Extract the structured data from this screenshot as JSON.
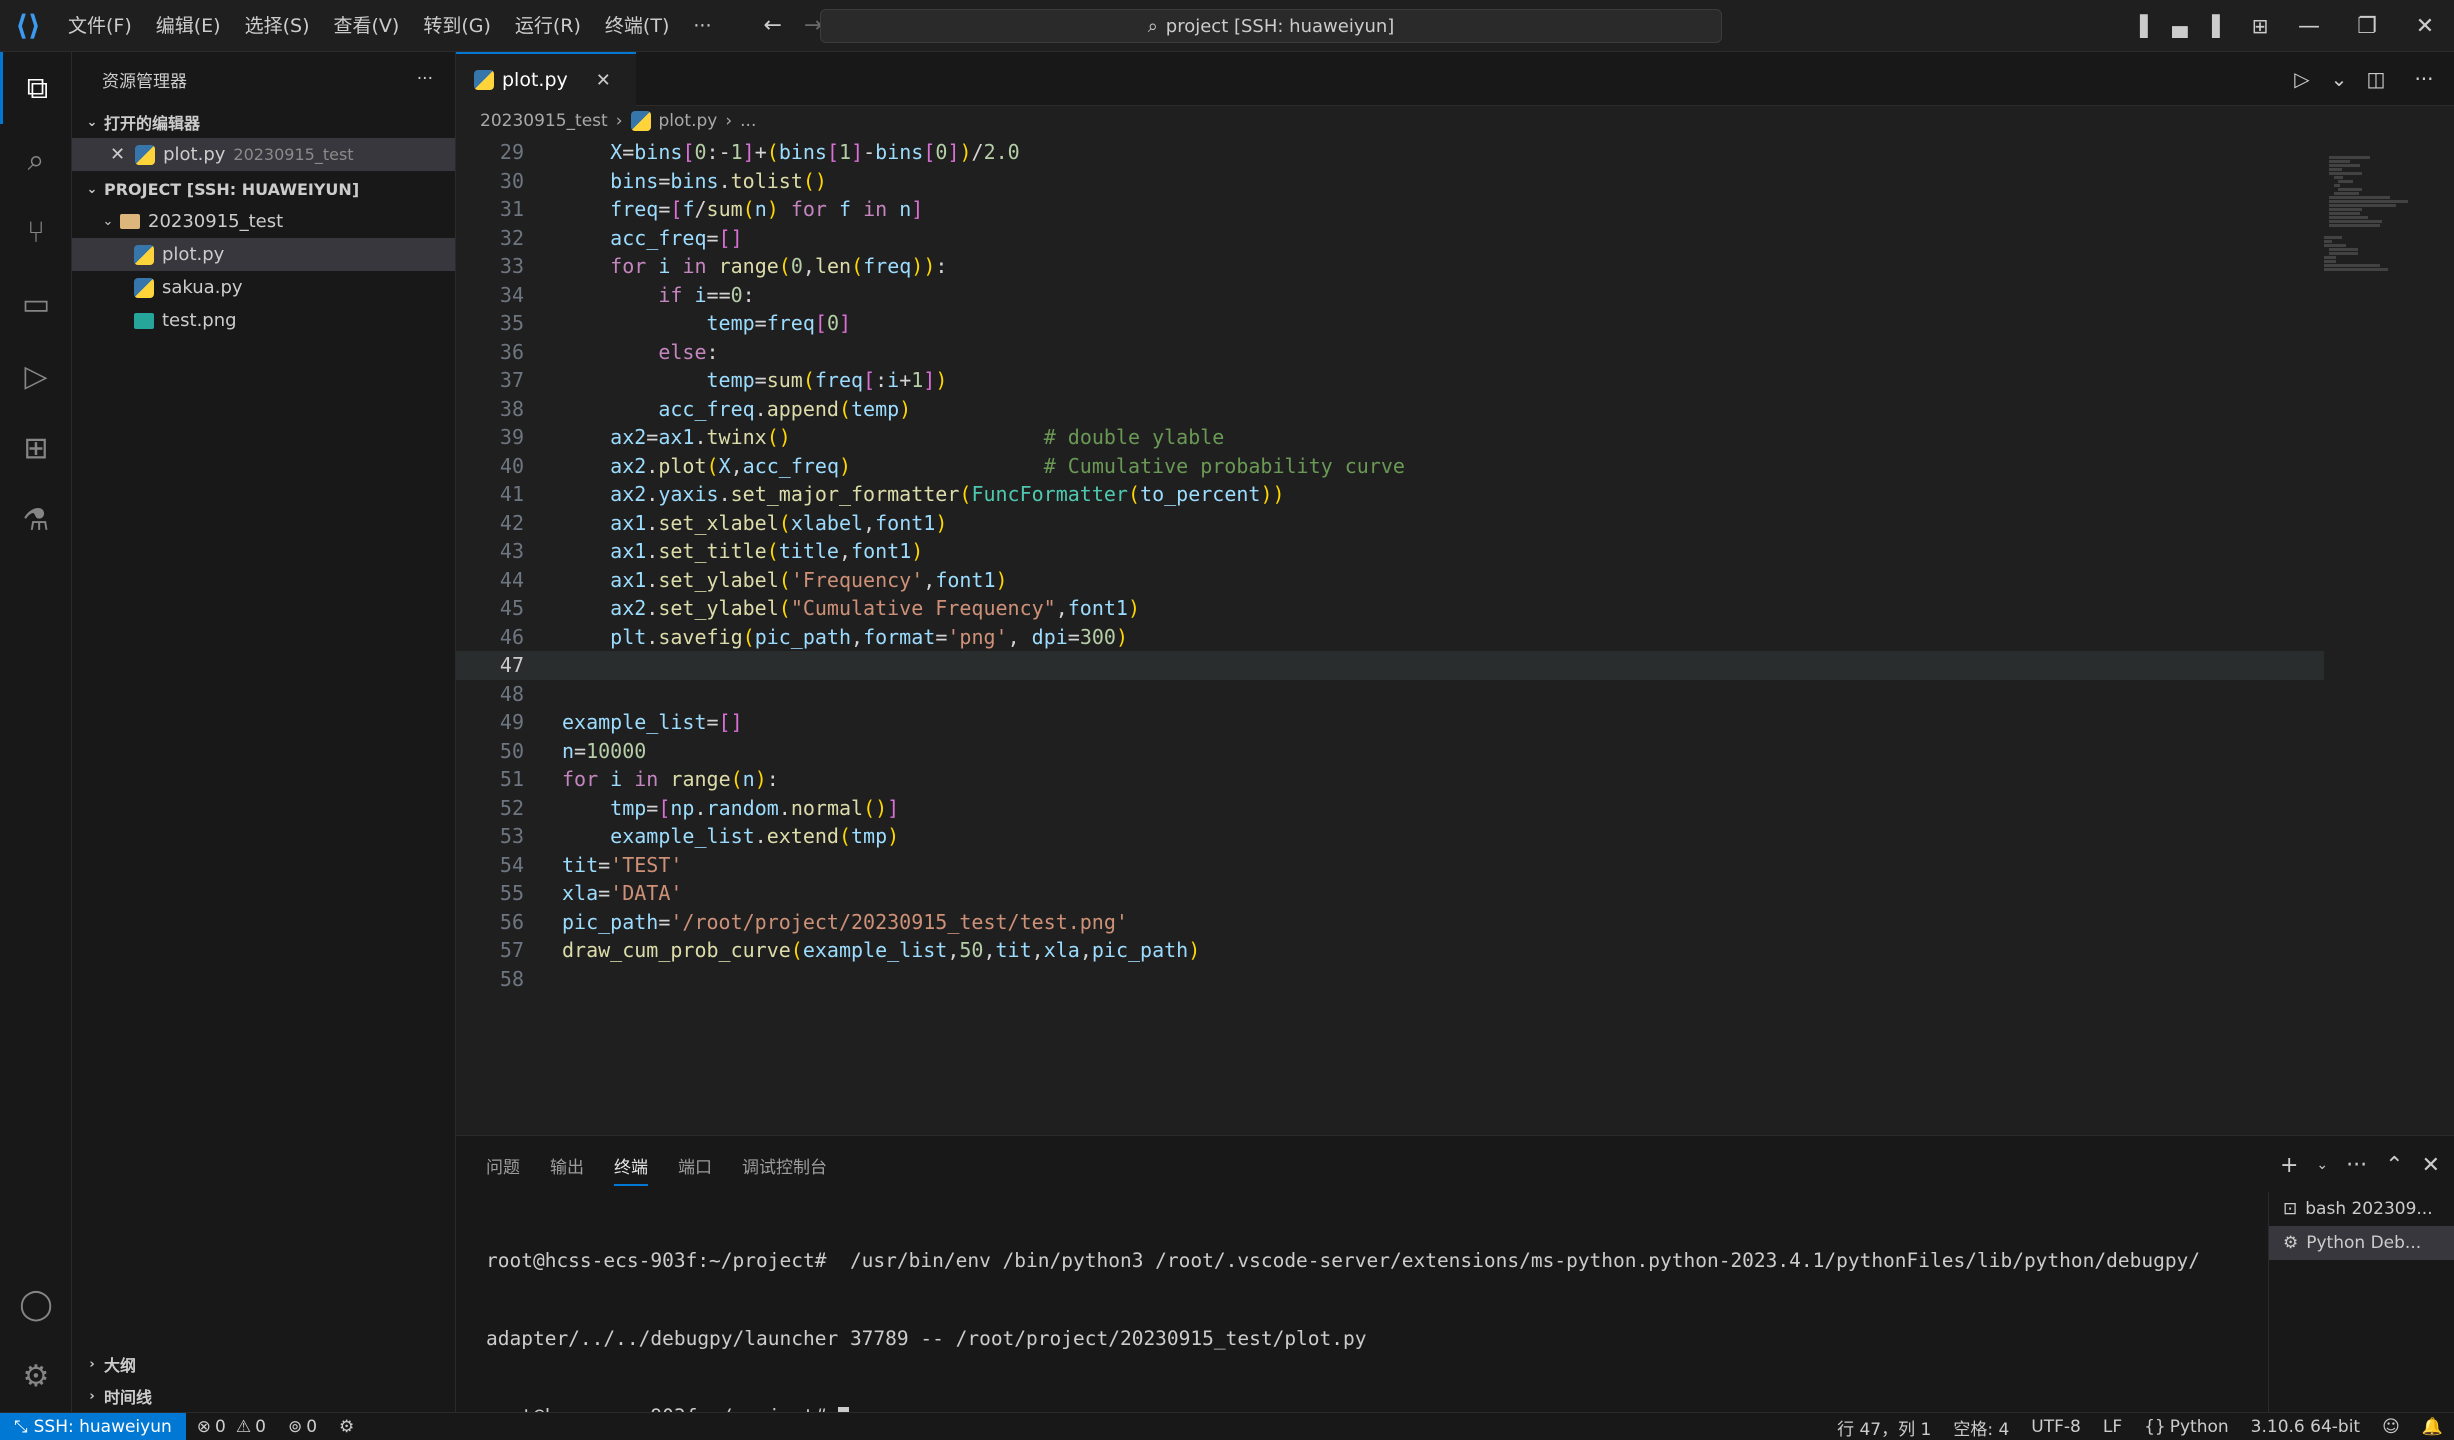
{
  "menu": [
    "文件(F)",
    "编辑(E)",
    "选择(S)",
    "查看(V)",
    "转到(G)",
    "运行(R)",
    "终端(T)",
    "···"
  ],
  "command_center": "project [SSH: huaweiyun]",
  "explorer": {
    "title": "资源管理器",
    "open_editors_label": "打开的编辑器",
    "open_file": "plot.py",
    "open_file_path": "20230915_test",
    "project_label": "PROJECT [SSH: HUAWEIYUN]",
    "folder": "20230915_test",
    "files": [
      "plot.py",
      "sakua.py",
      "test.png"
    ],
    "outline_label": "大纲",
    "timeline_label": "时间线"
  },
  "tab": {
    "label": "plot.py"
  },
  "breadcrumb": {
    "folder": "20230915_test",
    "file": "plot.py",
    "more": "..."
  },
  "code": {
    "current_line": 47,
    "lines": [
      {
        "n": "29",
        "t": "    X=bins[0:-1]+(bins[1]-bins[0])/2.0"
      },
      {
        "n": "30",
        "t": "    bins=bins.tolist()"
      },
      {
        "n": "31",
        "t": "    freq=[f/sum(n) for f in n]"
      },
      {
        "n": "32",
        "t": "    acc_freq=[]"
      },
      {
        "n": "33",
        "t": "    for i in range(0,len(freq)):"
      },
      {
        "n": "34",
        "t": "        if i==0:"
      },
      {
        "n": "35",
        "t": "            temp=freq[0]"
      },
      {
        "n": "36",
        "t": "        else:"
      },
      {
        "n": "37",
        "t": "            temp=sum(freq[:i+1])"
      },
      {
        "n": "38",
        "t": "        acc_freq.append(temp)"
      },
      {
        "n": "39",
        "t": "    ax2=ax1.twinx()                     # double ylable"
      },
      {
        "n": "40",
        "t": "    ax2.plot(X,acc_freq)                # Cumulative probability curve"
      },
      {
        "n": "41",
        "t": "    ax2.yaxis.set_major_formatter(FuncFormatter(to_percent))"
      },
      {
        "n": "42",
        "t": "    ax1.set_xlabel(xlabel,font1)"
      },
      {
        "n": "43",
        "t": "    ax1.set_title(title,font1)"
      },
      {
        "n": "44",
        "t": "    ax1.set_ylabel('Frequency',font1)"
      },
      {
        "n": "45",
        "t": "    ax2.set_ylabel(\"Cumulative Frequency\",font1)"
      },
      {
        "n": "46",
        "t": "    plt.savefig(pic_path,format='png', dpi=300)"
      },
      {
        "n": "47",
        "t": ""
      },
      {
        "n": "48",
        "t": ""
      },
      {
        "n": "49",
        "t": "example_list=[]"
      },
      {
        "n": "50",
        "t": "n=10000"
      },
      {
        "n": "51",
        "t": "for i in range(n):"
      },
      {
        "n": "52",
        "t": "    tmp=[np.random.normal()]"
      },
      {
        "n": "53",
        "t": "    example_list.extend(tmp)"
      },
      {
        "n": "54",
        "t": "tit='TEST'"
      },
      {
        "n": "55",
        "t": "xla='DATA'"
      },
      {
        "n": "56",
        "t": "pic_path='/root/project/20230915_test/test.png'"
      },
      {
        "n": "57",
        "t": "draw_cum_prob_curve(example_list,50,tit,xla,pic_path)"
      },
      {
        "n": "58",
        "t": ""
      }
    ]
  },
  "panel": {
    "tabs": [
      "问题",
      "输出",
      "终端",
      "端口",
      "调试控制台"
    ],
    "active_tab": "终端",
    "terminal_lines": [
      "root@hcss-ecs-903f:~/project#  /usr/bin/env /bin/python3 /root/.vscode-server/extensions/ms-python.python-2023.4.1/pythonFiles/lib/python/debugpy/",
      "adapter/../../debugpy/launcher 37789 -- /root/project/20230915_test/plot.py",
      "root@hcss-ecs-903f:~/project# "
    ],
    "terminals": [
      "bash 202309...",
      "Python Deb..."
    ]
  },
  "status": {
    "remote": "SSH: huaweiyun",
    "errors": "0",
    "warnings": "0",
    "ports": "0",
    "position": "行 47，列 1",
    "spaces": "空格: 4",
    "encoding": "UTF-8",
    "eol": "LF",
    "language": "Python",
    "interpreter": "3.10.6 64-bit"
  },
  "colors": {
    "accent": "#0078d4",
    "background": "#1f1f1f",
    "sidebar": "#181818"
  }
}
